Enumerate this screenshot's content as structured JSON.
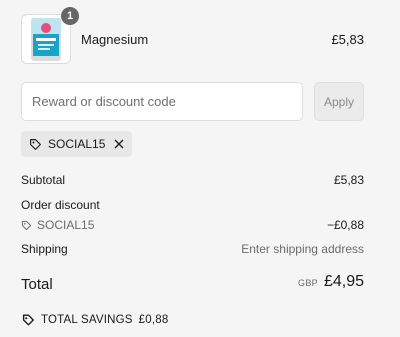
{
  "product": {
    "name": "Magnesium",
    "price": "£5,83",
    "quantity": "1",
    "image_icon": "supplement-pouch-image"
  },
  "discount": {
    "placeholder": "Reward or discount code",
    "apply_label": "Apply",
    "applied_code": "SOCIAL15"
  },
  "summary": {
    "subtotal_label": "Subtotal",
    "subtotal_value": "£5,83",
    "order_discount_label": "Order discount",
    "discount_code": "SOCIAL15",
    "discount_value": "−£0,88",
    "shipping_label": "Shipping",
    "shipping_value": "Enter shipping address",
    "total_label": "Total",
    "currency": "GBP",
    "total_value": "£4,95",
    "savings_label": "TOTAL SAVINGS",
    "savings_value": "£0,88"
  },
  "colors": {
    "background": "#f5f5f5",
    "text": "#1a1a1a",
    "muted_text": "#6b6b6b",
    "chip_background": "#e8e8e8",
    "badge_background": "#666666"
  }
}
